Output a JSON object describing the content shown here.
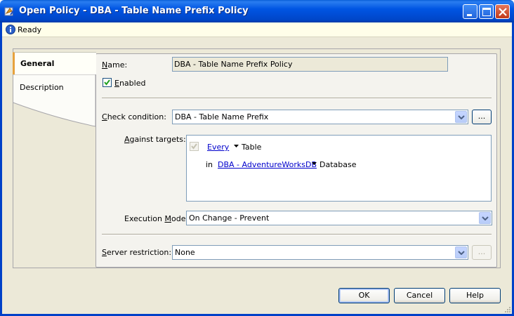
{
  "window": {
    "title": "Open Policy - DBA - Table Name Prefix Policy"
  },
  "status": {
    "text": "Ready",
    "icon": "info-icon"
  },
  "tabs": {
    "general": "General",
    "description": "Description"
  },
  "form": {
    "name_label_pre": "",
    "name_label_u": "N",
    "name_label_post": "ame:",
    "name_value": "DBA - Table Name Prefix Policy",
    "enabled_label_pre": "",
    "enabled_label_u": "E",
    "enabled_label_post": "nabled",
    "check_condition_label_pre": "",
    "check_condition_label_u": "C",
    "check_condition_label_post": "heck condition:",
    "check_condition_value": "DBA - Table Name Prefix",
    "ellipsis": "...",
    "against_targets_label_pre": "",
    "against_targets_label_u": "A",
    "against_targets_label_post": "gainst targets:",
    "target_row1_link": "Every",
    "target_row1_type": "Table",
    "target_row2_prefix": "in",
    "target_row2_link": "DBA - AdventureWorksDB",
    "target_row2_type": "Database",
    "execution_mode_label_pre": "Execution ",
    "execution_mode_label_u": "M",
    "execution_mode_label_post": "ode:",
    "execution_mode_value": "On Change - Prevent",
    "server_restriction_label_pre": "",
    "server_restriction_label_u": "S",
    "server_restriction_label_post": "erver restriction:",
    "server_restriction_value": "None"
  },
  "buttons": {
    "ok": "OK",
    "cancel": "Cancel",
    "help": "Help"
  },
  "colors": {
    "titlebar": "#0055e3",
    "tab_accent": "#e7a23c",
    "link": "#0000cc"
  }
}
